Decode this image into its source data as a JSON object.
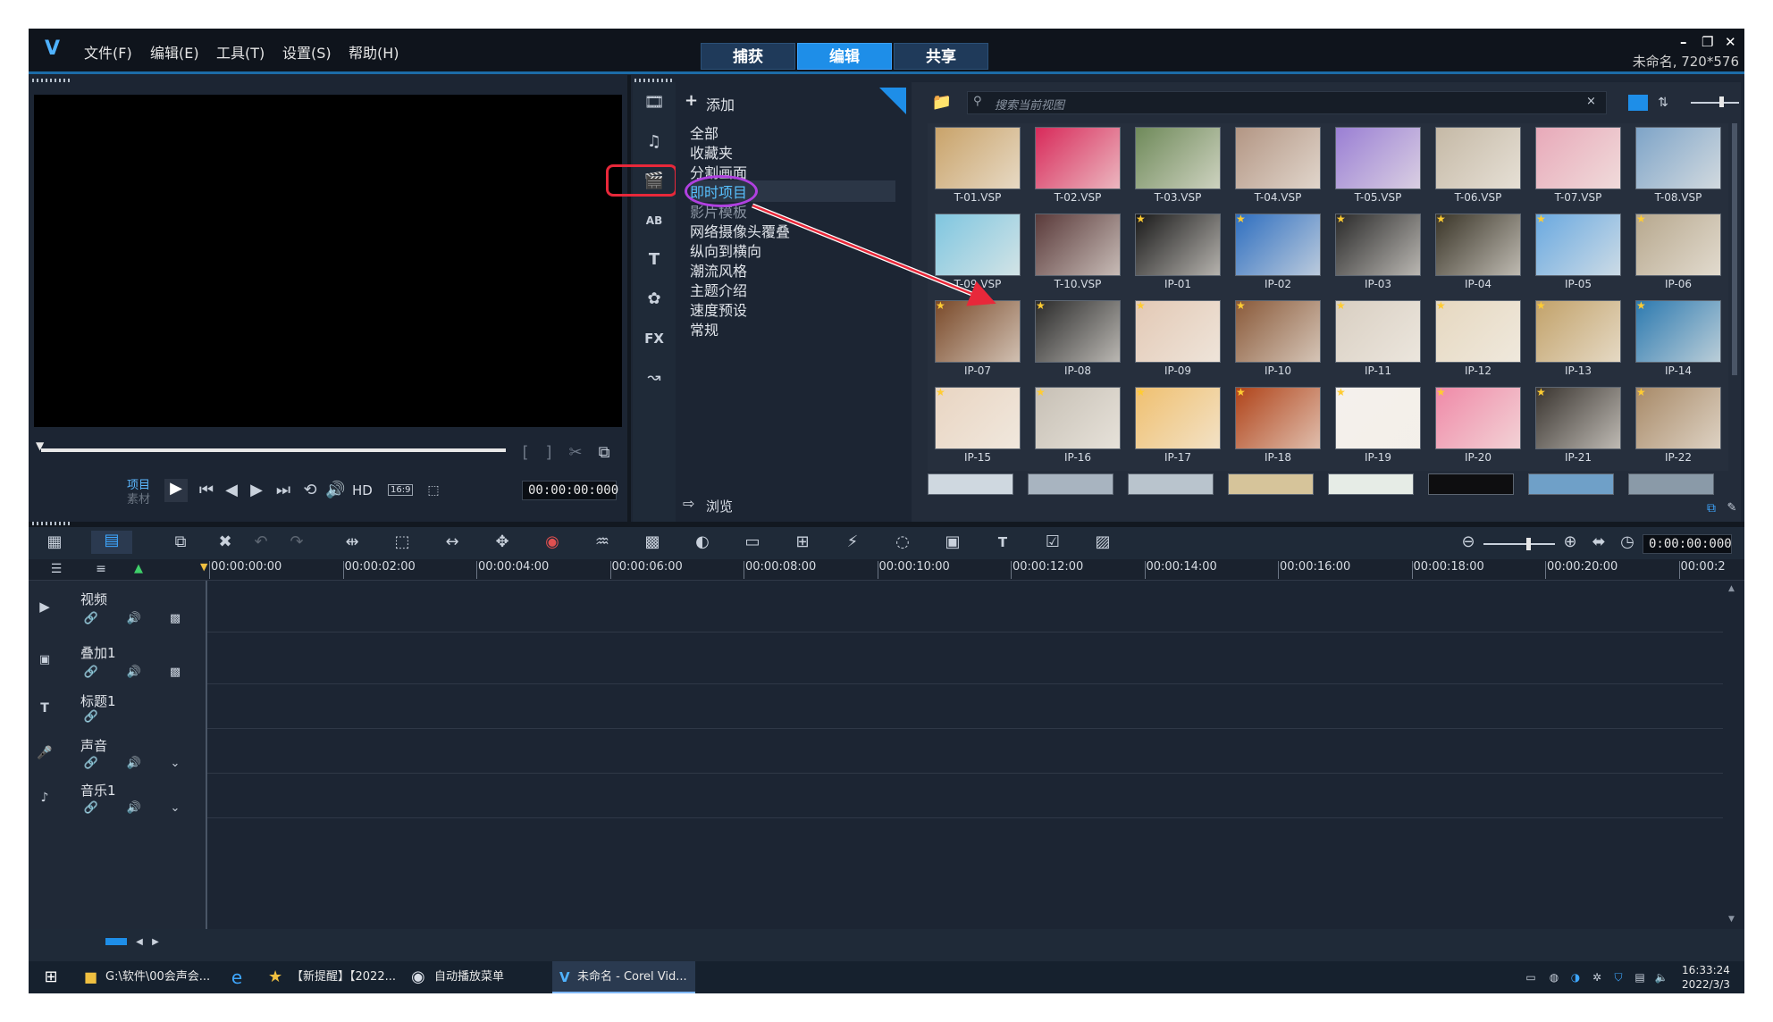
{
  "menu": {
    "file": "文件(F)",
    "edit": "编辑(E)",
    "tools": "工具(T)",
    "settings": "设置(S)",
    "help": "帮助(H)"
  },
  "modes": {
    "capture": "捕获",
    "edit": "编辑",
    "share": "共享"
  },
  "window": {
    "project_info": "未命名, 720*576"
  },
  "player": {
    "project_label": "项目",
    "clip_label": "素材",
    "hd_label": "HD",
    "aspect": "16:9",
    "timecode": "00:00:00:000"
  },
  "library": {
    "add_label": "添加",
    "browse_label": "浏览",
    "search_placeholder": "搜索当前视图",
    "categories": [
      "全部",
      "收藏夹",
      "分割画面",
      "即时项目",
      "影片模板",
      "网络摄像头覆叠",
      "纵向到横向",
      "潮流风格",
      "主题介绍",
      "速度预设",
      "常规"
    ],
    "thumbnails": [
      {
        "label": "T-01.VSP",
        "color": "#c9a36a"
      },
      {
        "label": "T-02.VSP",
        "color": "#d82a5a"
      },
      {
        "label": "T-03.VSP",
        "color": "#6f8a5a"
      },
      {
        "label": "T-04.VSP",
        "color": "#b39684"
      },
      {
        "label": "T-05.VSP",
        "color": "#9a7fd4"
      },
      {
        "label": "T-06.VSP",
        "color": "#c5b9a6"
      },
      {
        "label": "T-07.VSP",
        "color": "#e8a9b9"
      },
      {
        "label": "T-08.VSP",
        "color": "#7ea4c8"
      },
      {
        "label": "T-09.VSP",
        "color": "#7fc6e0"
      },
      {
        "label": "T-10.VSP",
        "color": "#5a3a3a"
      },
      {
        "label": "IP-01",
        "color": "#1a1a1a"
      },
      {
        "label": "IP-02",
        "color": "#2f6fc0"
      },
      {
        "label": "IP-03",
        "color": "#2a2a2a"
      },
      {
        "label": "IP-04",
        "color": "#3a3528"
      },
      {
        "label": "IP-05",
        "color": "#6aa9e0"
      },
      {
        "label": "IP-06",
        "color": "#b7a88e"
      },
      {
        "label": "IP-07",
        "color": "#7a4a2a"
      },
      {
        "label": "IP-08",
        "color": "#2b2b2b"
      },
      {
        "label": "IP-09",
        "color": "#e3c9b5"
      },
      {
        "label": "IP-10",
        "color": "#8a5a3a"
      },
      {
        "label": "IP-11",
        "color": "#d9cfc2"
      },
      {
        "label": "IP-12",
        "color": "#e6d8c0"
      },
      {
        "label": "IP-13",
        "color": "#c2a26a"
      },
      {
        "label": "IP-14",
        "color": "#2d7ab0"
      },
      {
        "label": "IP-15",
        "color": "#e9d5c2"
      },
      {
        "label": "IP-16",
        "color": "#c7c0b5"
      },
      {
        "label": "IP-17",
        "color": "#f0c070"
      },
      {
        "label": "IP-18",
        "color": "#b0441a"
      },
      {
        "label": "IP-19",
        "color": "#f4f0ec"
      },
      {
        "label": "IP-20",
        "color": "#f08aa8"
      },
      {
        "label": "IP-21",
        "color": "#3a3530"
      },
      {
        "label": "IP-22",
        "color": "#a88a68"
      }
    ]
  },
  "timeline": {
    "timecode": "0:00:00:000",
    "ruler": [
      "00:00:00:00",
      "00:00:02:00",
      "00:00:04:00",
      "00:00:06:00",
      "00:00:08:00",
      "00:00:10:00",
      "00:00:12:00",
      "00:00:14:00",
      "00:00:16:00",
      "00:00:18:00",
      "00:00:20:00",
      "00:00:2"
    ],
    "tracks": [
      "视频",
      "叠加1",
      "标题1",
      "声音",
      "音乐1"
    ]
  },
  "taskbar": {
    "items": [
      "G:\\软件\\00会声会...",
      "【新提醒】【2022...",
      "自动播放菜单",
      "未命名 - Corel Vid..."
    ],
    "time": "16:33:24",
    "date": "2022/3/3"
  },
  "colors": {
    "accent": "#1e8ee8",
    "annotation_red": "#e8283a",
    "annotation_purple": "#b040e0"
  }
}
